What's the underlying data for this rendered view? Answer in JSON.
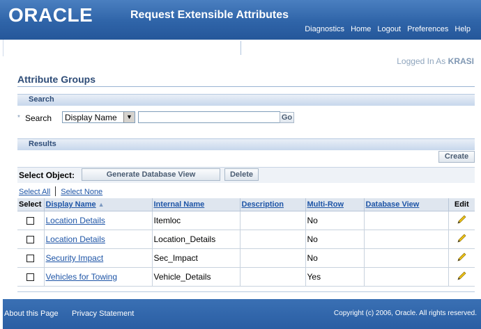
{
  "header": {
    "logo": "ORACLE",
    "title": "Request Extensible Attributes",
    "links": [
      "Diagnostics",
      "Home",
      "Logout",
      "Preferences",
      "Help"
    ]
  },
  "user": {
    "logged_in_label": "Logged In As",
    "username": "KRASI"
  },
  "page": {
    "title": "Attribute Groups"
  },
  "search": {
    "section_title": "Search",
    "label": "Search",
    "field_select_value": "Display Name",
    "input_value": "",
    "go_label": "Go"
  },
  "results": {
    "section_title": "Results",
    "create_label": "Create",
    "select_object_label": "Select Object:",
    "generate_label": "Generate Database View",
    "delete_label": "Delete",
    "select_all_label": "Select All",
    "select_none_label": "Select None",
    "columns": [
      "Select",
      "Display Name",
      "Internal Name",
      "Description",
      "Multi-Row",
      "Database View",
      "Edit"
    ],
    "rows": [
      {
        "display_name": "Location Details",
        "internal_name": "Itemloc",
        "description": "",
        "multi_row": "No",
        "database_view": ""
      },
      {
        "display_name": "Location Details",
        "internal_name": "Location_Details",
        "description": "",
        "multi_row": "No",
        "database_view": ""
      },
      {
        "display_name": "Security Impact",
        "internal_name": "Sec_Impact",
        "description": "",
        "multi_row": "No",
        "database_view": ""
      },
      {
        "display_name": "Vehicles for Towing",
        "internal_name": "Vehicle_Details",
        "description": "",
        "multi_row": "Yes",
        "database_view": ""
      }
    ]
  },
  "footer": {
    "about_label": "About this Page",
    "privacy_label": "Privacy Statement",
    "copyright": "Copyright (c) 2006, Oracle. All rights reserved."
  },
  "colors": {
    "header_blue": "#2f64a8",
    "link_blue": "#1d54a6",
    "title_navy": "#2e4c77",
    "edit_icon": "#f0c419"
  },
  "icons": {
    "sort": "sort-ascending-icon",
    "edit": "pencil-edit-icon",
    "dropdown": "chevron-down-icon",
    "required": "required-asterisk-icon"
  }
}
